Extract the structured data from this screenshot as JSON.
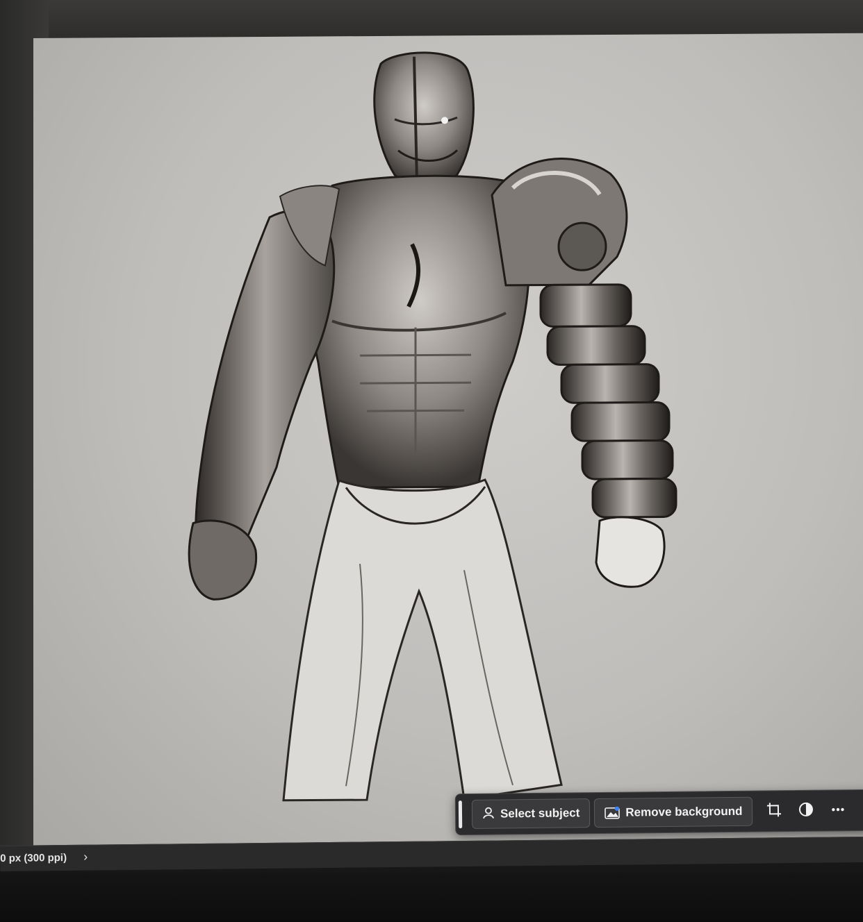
{
  "toolbar": {
    "select_subject_label": "Select subject",
    "remove_background_label": "Remove background",
    "crop_icon": "crop-icon",
    "adjust_icon": "adjustment-icon",
    "more_label": "•••"
  },
  "status": {
    "doc_info": "0 px (300 ppi)",
    "arrow": "›"
  },
  "colors": {
    "canvas_bg": "#c4c2bf",
    "toolbar_bg": "#2b2b2d",
    "button_bg": "#3a3a3c",
    "badge_blue": "#3b82f6"
  }
}
